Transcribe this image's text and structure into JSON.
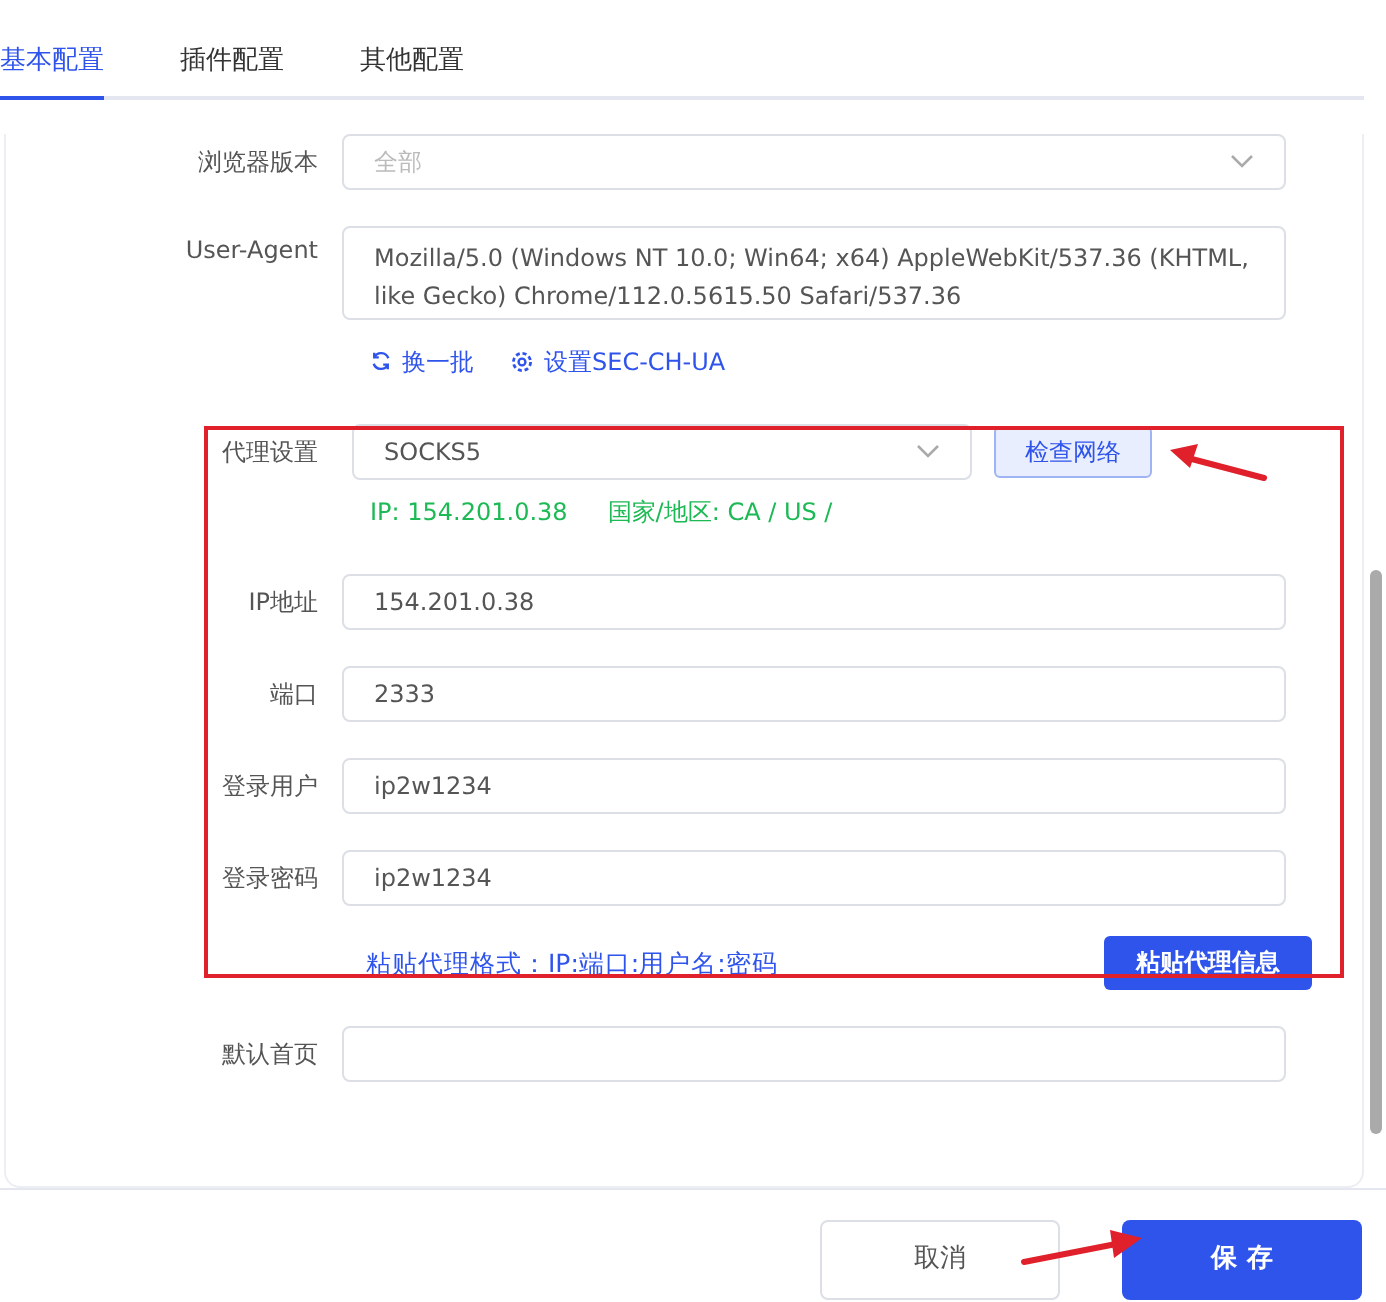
{
  "tabs": [
    {
      "label": "基本配置",
      "selected": true
    },
    {
      "label": "插件配置",
      "selected": false
    },
    {
      "label": "其他配置",
      "selected": false
    }
  ],
  "form": {
    "browser_version": {
      "label": "浏览器版本",
      "placeholder": "全部"
    },
    "user_agent": {
      "label": "User-Agent",
      "value": "Mozilla/5.0 (Windows NT 10.0; Win64; x64) AppleWebKit/537.36 (KHTML, like Gecko) Chrome/112.0.5615.50 Safari/537.36"
    },
    "links": [
      {
        "kind": "refresh",
        "label": "换一批"
      },
      {
        "kind": "settings",
        "label": "设置SEC-CH-UA"
      }
    ],
    "proxy": {
      "label": "代理设置",
      "value": "SOCKS5",
      "button": "检查网络",
      "ip_info": "IP: 154.201.0.38",
      "region_info": "国家/地区: CA / US /"
    },
    "fields": [
      {
        "label": "IP地址",
        "value": "154.201.0.38"
      },
      {
        "label": "端口",
        "value": "2333"
      },
      {
        "label": "登录用户",
        "value": "ip2w1234"
      },
      {
        "label": "登录密码",
        "value": "ip2w1234"
      }
    ],
    "paste_hint": "粘贴代理格式：IP:端口:用户名:密码",
    "paste_button": "粘贴代理信息",
    "homepage": {
      "label": "默认首页"
    }
  },
  "buttons": [
    {
      "kind": "cancel",
      "label": "取消"
    },
    {
      "kind": "primary",
      "label": "保 存"
    }
  ]
}
